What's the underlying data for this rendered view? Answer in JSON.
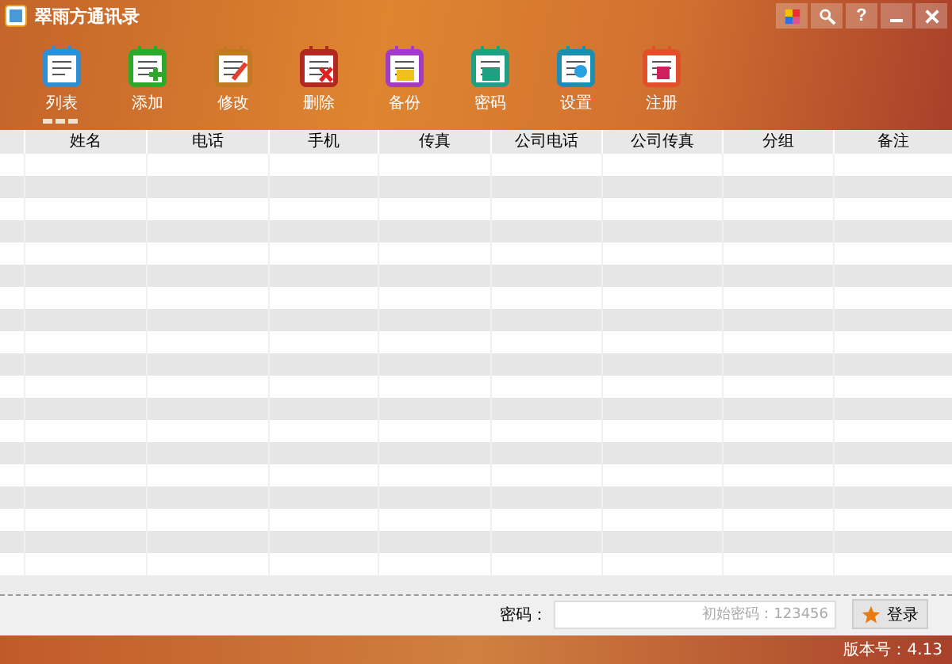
{
  "window": {
    "title": "翠雨方通讯录",
    "buttons": [
      {
        "kind": "theme"
      },
      {
        "kind": "search"
      },
      {
        "kind": "help",
        "label": "?"
      },
      {
        "kind": "minimize"
      },
      {
        "kind": "close"
      }
    ]
  },
  "toolbar": [
    {
      "label": "列表",
      "selected": true,
      "color": "#2f8fd6",
      "kind": "list"
    },
    {
      "label": "添加",
      "selected": false,
      "color": "#2ea82a",
      "kind": "add"
    },
    {
      "label": "修改",
      "selected": false,
      "color": "#c27a22",
      "kind": "edit"
    },
    {
      "label": "删除",
      "selected": false,
      "color": "#b02a22",
      "kind": "delete"
    },
    {
      "label": "备份",
      "selected": false,
      "color": "#a43bc4",
      "kind": "backup"
    },
    {
      "label": "密码",
      "selected": false,
      "color": "#1fa083",
      "kind": "password"
    },
    {
      "label": "设置",
      "selected": false,
      "color": "#1b8fb0",
      "kind": "settings"
    },
    {
      "label": "注册",
      "selected": false,
      "color": "#e0502a",
      "kind": "register"
    }
  ],
  "table": {
    "columns": [
      "姓名",
      "电话",
      "手机",
      "传真",
      "公司电话",
      "公司传真",
      "分组",
      "备注"
    ]
  },
  "login": {
    "label": "密码：",
    "placeholder": "初始密码：123456",
    "button": "登录"
  },
  "status_bar": {
    "version": "版本号：4.13"
  }
}
